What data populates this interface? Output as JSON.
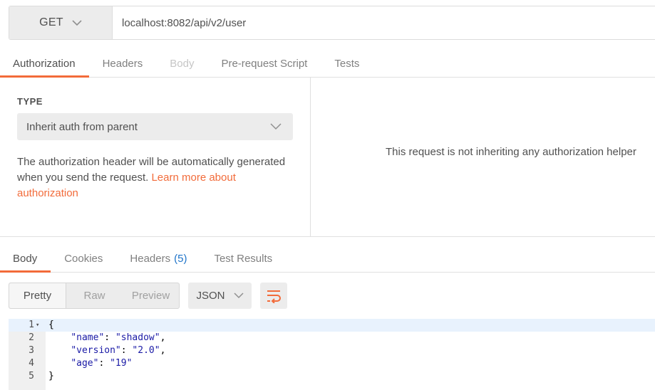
{
  "request": {
    "method": "GET",
    "url": "localhost:8082/api/v2/user"
  },
  "request_tabs": [
    {
      "label": "Authorization",
      "state": "active"
    },
    {
      "label": "Headers",
      "state": "normal"
    },
    {
      "label": "Body",
      "state": "disabled"
    },
    {
      "label": "Pre-request Script",
      "state": "normal"
    },
    {
      "label": "Tests",
      "state": "normal"
    }
  ],
  "auth": {
    "type_label": "TYPE",
    "type_value": "Inherit auth from parent",
    "description": "The authorization header will be automatically generated when you send the request. ",
    "learn_more": "Learn more about authorization",
    "right_message": "This request is not inheriting any authorization helper"
  },
  "response_tabs": [
    {
      "label": "Body",
      "state": "active"
    },
    {
      "label": "Cookies",
      "state": "normal"
    },
    {
      "label": "Headers",
      "count": "(5)",
      "state": "normal"
    },
    {
      "label": "Test Results",
      "state": "normal"
    }
  ],
  "toolbar": {
    "format_buttons": [
      "Pretty",
      "Raw",
      "Preview"
    ],
    "language": "JSON",
    "wrap_icon": "wrap-lines-icon"
  },
  "code_lines": [
    {
      "num": "1",
      "text": "{",
      "fold": true
    },
    {
      "num": "2",
      "indent": "    ",
      "key": "\"name\"",
      "value": "\"shadow\"",
      "comma": ","
    },
    {
      "num": "3",
      "indent": "    ",
      "key": "\"version\"",
      "value": "\"2.0\"",
      "comma": ","
    },
    {
      "num": "4",
      "indent": "    ",
      "key": "\"age\"",
      "value": "\"19\"",
      "comma": ""
    },
    {
      "num": "5",
      "text": "}"
    }
  ],
  "colors": {
    "accent": "#f26b3a",
    "count_blue": "#1f74c9",
    "code_string": "#1a1aa6",
    "active_line": "#e8f2fd"
  }
}
